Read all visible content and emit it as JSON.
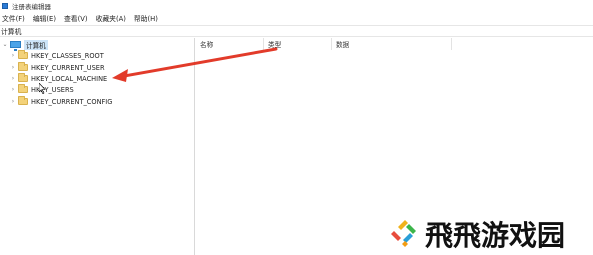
{
  "window": {
    "title": "注册表编辑器"
  },
  "menu": [
    "文件(F)",
    "编辑(E)",
    "查看(V)",
    "收藏夹(A)",
    "帮助(H)"
  ],
  "address": {
    "path": "计算机"
  },
  "tree": {
    "root": {
      "label": "计算机",
      "icon": "computer-icon",
      "expanded": true
    },
    "children": [
      {
        "label": "HKEY_CLASSES_ROOT",
        "icon": "folder-icon"
      },
      {
        "label": "HKEY_CURRENT_USER",
        "icon": "folder-icon"
      },
      {
        "label": "HKEY_LOCAL_MACHINE",
        "icon": "folder-icon"
      },
      {
        "label": "HKEY_USERS",
        "icon": "folder-icon"
      },
      {
        "label": "HKEY_CURRENT_CONFIG",
        "icon": "folder-icon"
      }
    ]
  },
  "list": {
    "columns": [
      "名称",
      "类型",
      "数据"
    ]
  },
  "annotation": {
    "arrow_color": "#e23b2a",
    "points_to": "HKEY_LOCAL_MACHINE"
  },
  "watermark": {
    "text": "飛飛游戏园"
  },
  "colors": {
    "selection": "#cce4f7",
    "folder": "#f3d27a",
    "accent": "#2b7bd6"
  }
}
